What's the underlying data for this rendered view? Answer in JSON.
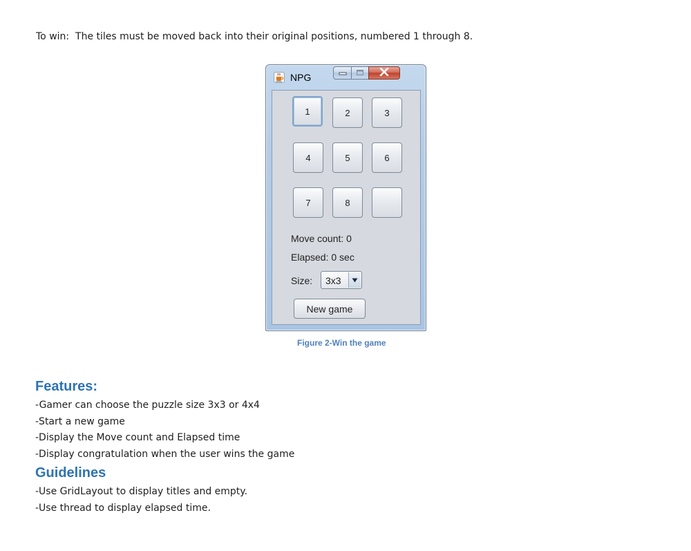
{
  "intro": "To win:  The tiles must be moved back into their original positions, numbered 1 through 8.",
  "window": {
    "title": "NPG",
    "icon": "java-cup-icon",
    "controls": [
      "minimize-icon",
      "maximize-icon",
      "close-icon"
    ],
    "tiles": [
      "1",
      "2",
      "3",
      "4",
      "5",
      "6",
      "7",
      "8",
      ""
    ],
    "move_count": "Move count: 0",
    "elapsed": "Elapsed: 0 sec",
    "size_label": "Size:",
    "size_value": "3x3",
    "new_game": "New game"
  },
  "caption": "Figure 2-Win the game",
  "features": {
    "heading": "Features:",
    "items": [
      "-Gamer can choose the puzzle size 3x3 or 4x4",
      "-Start a new game",
      "-Display the Move count and Elapsed time",
      "-Display congratulation when the user wins the game"
    ]
  },
  "guidelines": {
    "heading": "Guidelines",
    "items": [
      "-Use GridLayout to display titles and empty.",
      "-Use thread to display elapsed time."
    ]
  },
  "colors": {
    "heading": "#2e74b5",
    "caption": "#4f81bd",
    "close_button": "#c0422c"
  }
}
